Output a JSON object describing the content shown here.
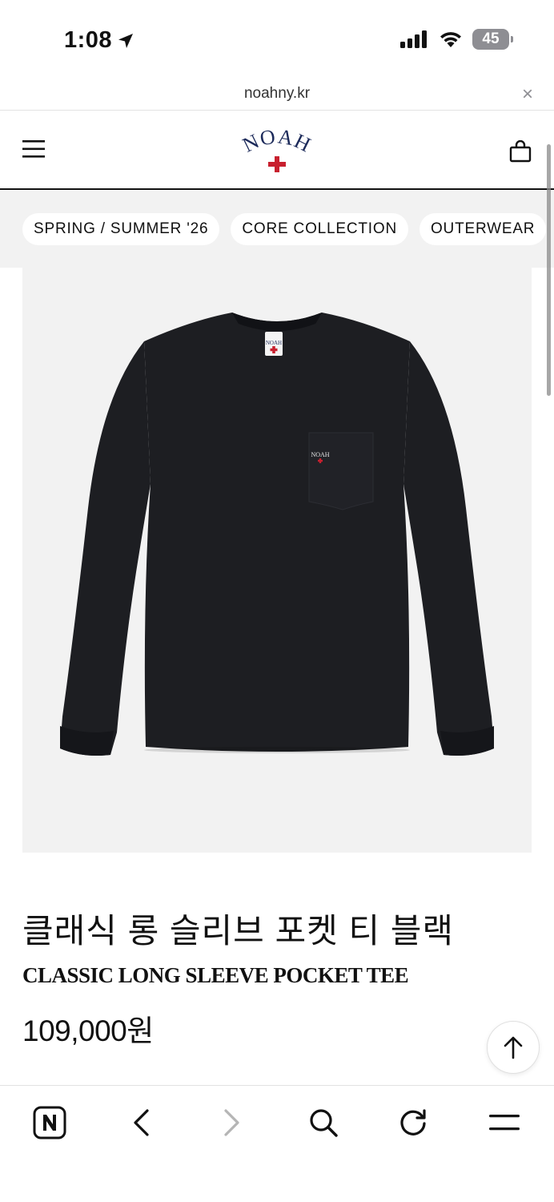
{
  "status_bar": {
    "time": "1:08",
    "battery": "45"
  },
  "browser": {
    "url": "noahny.kr",
    "close_glyph": "×"
  },
  "header": {
    "logo_text": "NOAH"
  },
  "categories": [
    {
      "label": "SPRING / SUMMER '26"
    },
    {
      "label": "CORE COLLECTION"
    },
    {
      "label": "OUTERWEAR"
    }
  ],
  "product": {
    "title_ko": "클래식 롱 슬리브 포켓 티 블랙",
    "title_en": "CLASSIC LONG SLEEVE POCKET TEE",
    "price": "109,000원",
    "image_logo_text": "NOAH"
  },
  "colors": {
    "brand_navy": "#1c2a5a",
    "brand_red": "#c8202f",
    "garment": "#1d1e22",
    "image_bg": "#f2f2f2"
  },
  "icons": {
    "location": "location-arrow-icon",
    "signal": "signal-icon",
    "wifi": "wifi-icon",
    "menu": "hamburger-menu-icon",
    "bag": "shopping-bag-icon",
    "scroll_top": "arrow-up-icon",
    "naver": "naver-n-icon",
    "back": "chevron-left-icon",
    "forward": "chevron-right-icon",
    "search": "search-icon",
    "refresh": "refresh-icon",
    "more": "more-menu-icon"
  }
}
